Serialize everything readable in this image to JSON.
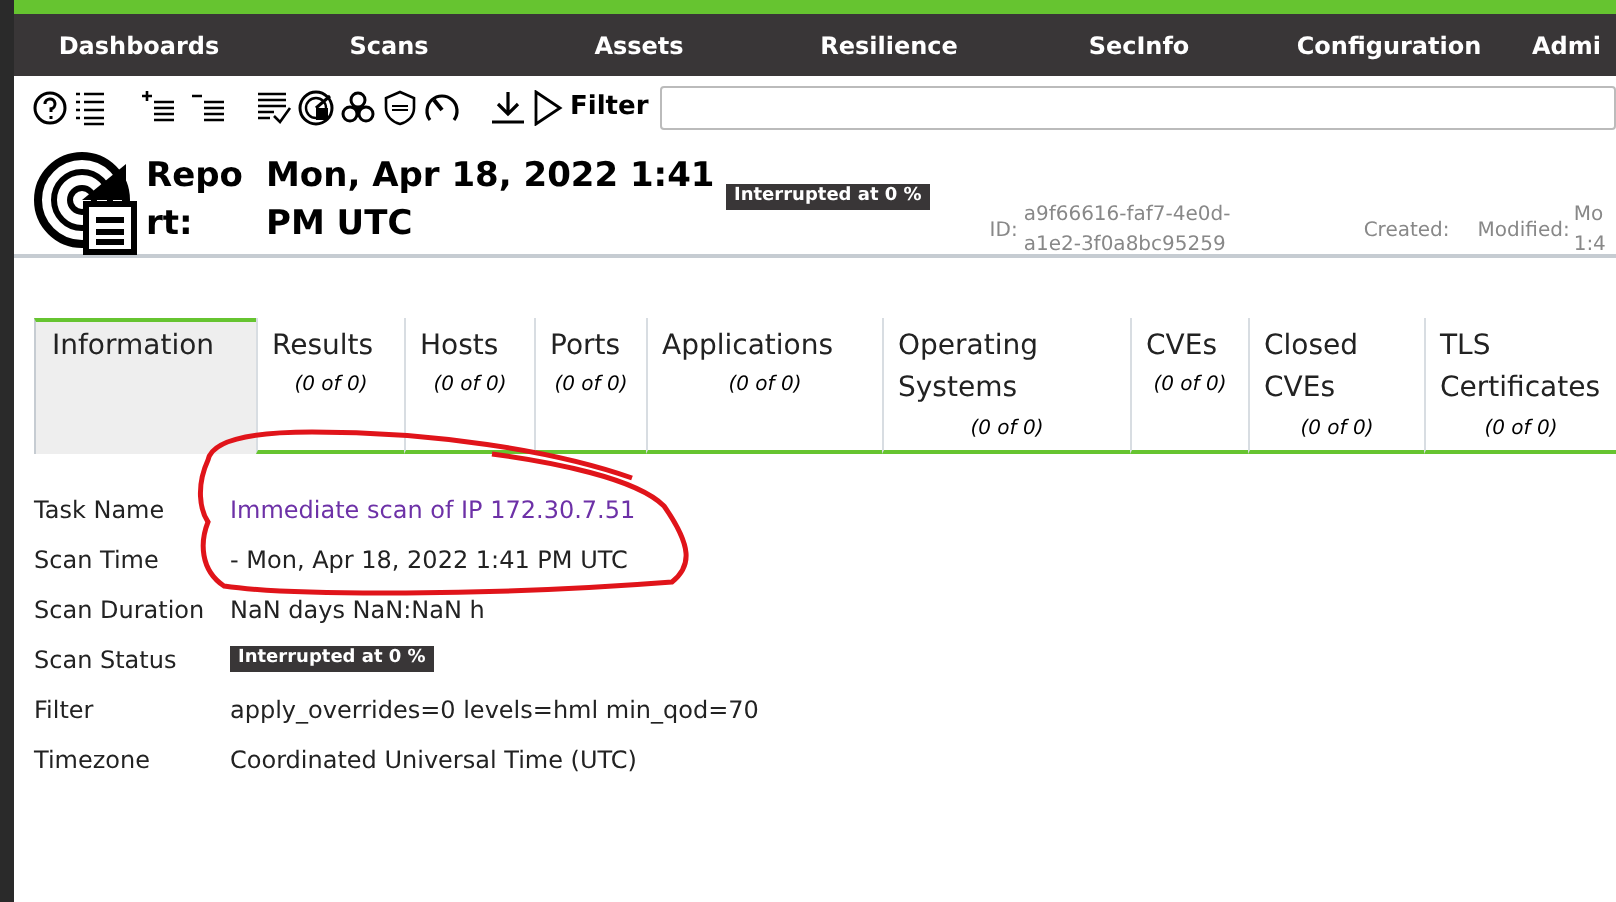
{
  "nav": {
    "items": [
      "Dashboards",
      "Scans",
      "Assets",
      "Resilience",
      "SecInfo",
      "Configuration",
      "Admi"
    ]
  },
  "toolbar": {
    "filter_label": "Filter"
  },
  "header": {
    "title": "Report:",
    "date": "Mon, Apr 18, 2022 1:41 PM UTC",
    "status": "Interrupted at 0 %",
    "id_label": "ID:",
    "id": "a9f66616-faf7-4e0d-a1e2-3f0a8bc95259",
    "created_label": "Created:",
    "modified_label": "Modified:",
    "modified": "Mo 1:4"
  },
  "tabs": [
    {
      "label": "Information",
      "selected": true
    },
    {
      "label": "Results",
      "count": "(0 of 0)",
      "selected": false
    },
    {
      "label": "Hosts",
      "count": "(0 of 0)",
      "selected": false
    },
    {
      "label": "Ports",
      "count": "(0 of 0)",
      "selected": false
    },
    {
      "label": "Applications",
      "count": "(0 of 0)",
      "selected": false
    },
    {
      "label": "Operating Systems",
      "count": "(0 of 0)",
      "selected": false
    },
    {
      "label": "CVEs",
      "count": "(0 of 0)",
      "selected": false
    },
    {
      "label": "Closed CVEs",
      "count": "(0 of 0)",
      "selected": false
    },
    {
      "label": "TLS Certificates",
      "count": "(0 of 0)",
      "selected": false
    }
  ],
  "info": [
    {
      "label": "Task Name",
      "value": "Immediate scan of IP 172.30.7.51",
      "kind": "link"
    },
    {
      "label": "Scan Time",
      "value": "- Mon, Apr 18, 2022 1:41 PM UTC",
      "kind": "text"
    },
    {
      "label": "Scan Duration",
      "value": "NaN days NaN:NaN h",
      "kind": "text"
    },
    {
      "label": "Scan Status",
      "value": "Interrupted at 0 %",
      "kind": "badge"
    },
    {
      "label": "Filter",
      "value": "apply_overrides=0 levels=hml min_qod=70",
      "kind": "text"
    },
    {
      "label": "Timezone",
      "value": "Coordinated Universal Time (UTC)",
      "kind": "text"
    }
  ]
}
